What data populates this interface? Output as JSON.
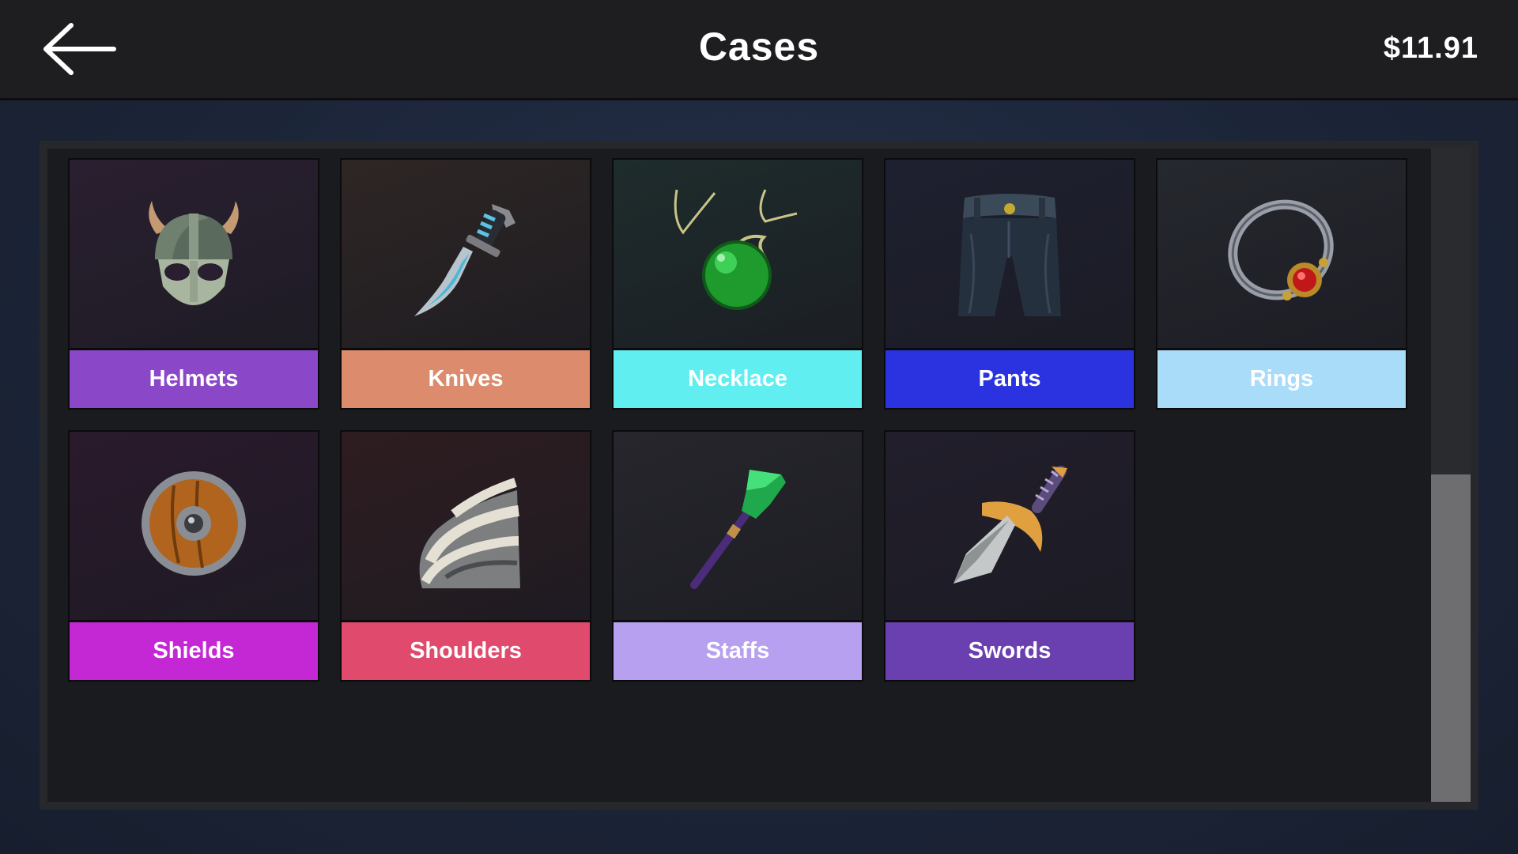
{
  "header": {
    "title": "Cases",
    "balance": "$11.91",
    "back_icon": "arrow-left-icon"
  },
  "cases": [
    {
      "label": "Helmets",
      "icon": "helmet-icon",
      "color": "#8a48c8",
      "bg": "#2a1f30"
    },
    {
      "label": "Knives",
      "icon": "knife-icon",
      "color": "#dc8c6c",
      "bg": "#2e2624"
    },
    {
      "label": "Necklace",
      "icon": "necklace-icon",
      "color": "#60eef0",
      "bg": "#1e2c2c"
    },
    {
      "label": "Pants",
      "icon": "pants-icon",
      "color": "#2b33e0",
      "bg": "#1e2030"
    },
    {
      "label": "Rings",
      "icon": "ring-icon",
      "color": "#a8dcf8",
      "bg": "#25282e"
    },
    {
      "label": "Shields",
      "icon": "shield-icon",
      "color": "#c428d4",
      "bg": "#2a1a2c"
    },
    {
      "label": "Shoulders",
      "icon": "shoulders-icon",
      "color": "#e04a6c",
      "bg": "#2e1c20"
    },
    {
      "label": "Staffs",
      "icon": "staff-icon",
      "color": "#b8a0f0",
      "bg": "#26262c"
    },
    {
      "label": "Swords",
      "icon": "sword-icon",
      "color": "#6a40b0",
      "bg": "#221e2c"
    }
  ]
}
